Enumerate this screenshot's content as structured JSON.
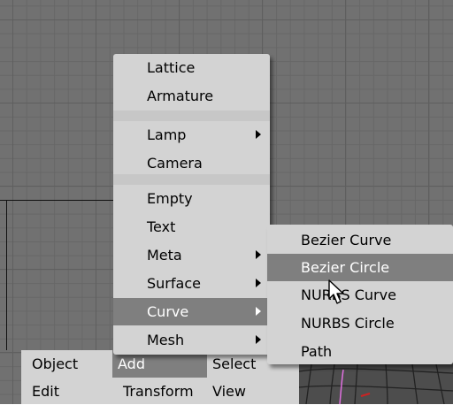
{
  "menu": {
    "items": [
      {
        "label": "Lattice"
      },
      {
        "label": "Armature"
      },
      {
        "label": "Lamp",
        "submenu": true
      },
      {
        "label": "Camera"
      },
      {
        "label": "Empty"
      },
      {
        "label": "Text"
      },
      {
        "label": "Meta",
        "submenu": true
      },
      {
        "label": "Surface",
        "submenu": true
      },
      {
        "label": "Curve",
        "submenu": true,
        "active": true
      },
      {
        "label": "Mesh",
        "submenu": true
      }
    ]
  },
  "submenu": {
    "items": [
      {
        "label": "Bezier Curve"
      },
      {
        "label": "Bezier Circle",
        "active": true
      },
      {
        "label": "NURBS Curve"
      },
      {
        "label": "NURBS Circle"
      },
      {
        "label": "Path"
      }
    ]
  },
  "bottom_menu": {
    "row1": [
      "Object",
      "Add",
      "Select"
    ],
    "row2": [
      "Edit",
      "Transform",
      "View"
    ],
    "active": "Add"
  },
  "colors": {
    "highlight": "#7f7f7f",
    "menu_bg": "#d3d3d3",
    "viewport_bg": "#717171"
  },
  "icons": {
    "cursor": "mouse-pointer-icon",
    "submenu_arrow": "triangle-right-icon"
  }
}
